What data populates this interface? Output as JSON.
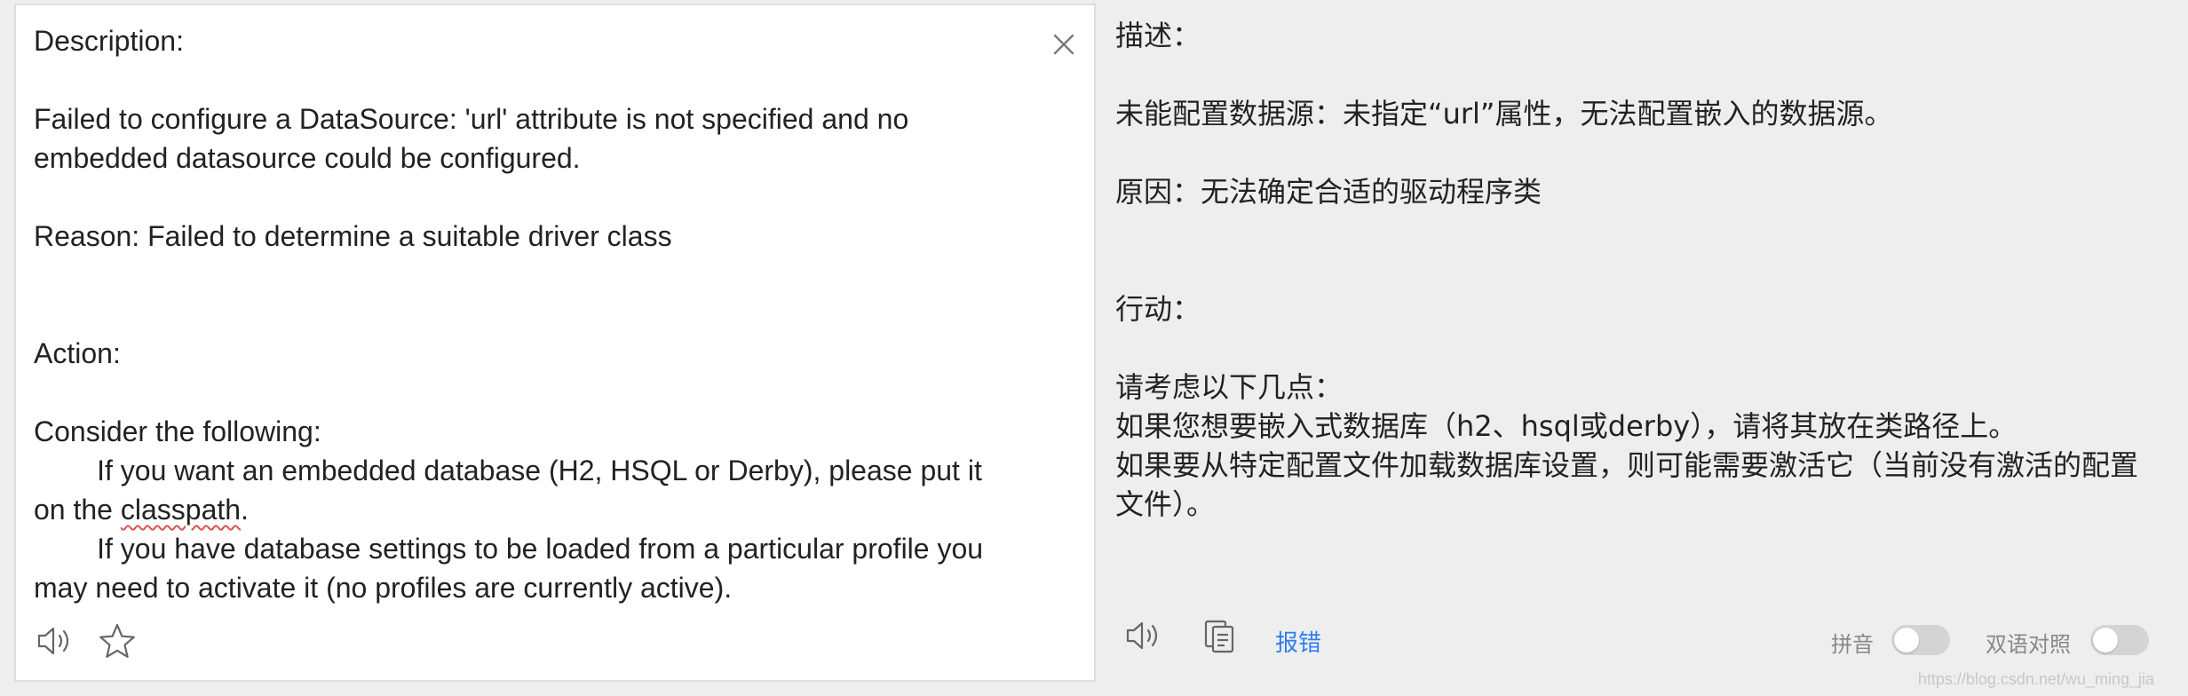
{
  "source": {
    "line_description": "Description:",
    "para_failed": "Failed to configure a DataSource: 'url' attribute is not specified and no\nembedded datasource could be configured.",
    "para_reason": "Reason: Failed to determine a suitable driver class",
    "line_action": "Action:",
    "line_consider": "Consider the following:",
    "item1_before": "        If you want an embedded database (H2, HSQL or Derby), please put it\non the ",
    "item1_flagged_word": "classpath",
    "item1_after": ".",
    "item2": "        If you have database settings to be loaded from a particular profile you\nmay need to activate it (no profiles are currently active).",
    "close_icon": "close-icon",
    "speaker_icon": "speaker-icon",
    "star_icon": "star-icon"
  },
  "translation": {
    "line_description": "描述：",
    "para_failed": "未能配置数据源：未指定“url”属性，无法配置嵌入的数据源。",
    "para_reason": "原因：无法确定合适的驱动程序类",
    "line_action": "行动：",
    "line_consider": "请考虑以下几点：",
    "item1": "如果您想要嵌入式数据库（h2、hsql或derby），请将其放在类路径上。",
    "item2": "如果要从特定配置文件加载数据库设置，则可能需要激活它（当前没有激活的配置\n文件）。",
    "speaker_icon": "speaker-icon",
    "copy_icon": "copy-icon",
    "report_label": "报错",
    "pinyin_label": "拼音",
    "pinyin_on": false,
    "bilingual_label": "双语对照",
    "bilingual_on": false
  },
  "colors": {
    "link": "#2e7ff0",
    "toggle_off": "#d4d4d4",
    "panel_border": "#dedede",
    "background": "#eeeeee"
  },
  "watermark": "https://blog.csdn.net/wu_ming_jia"
}
